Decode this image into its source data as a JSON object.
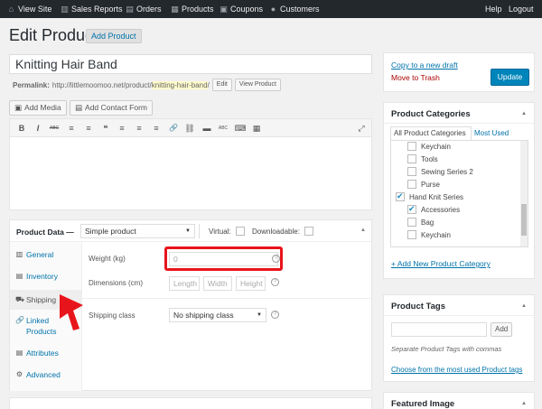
{
  "adminbar": {
    "items": [
      {
        "label": "View Site",
        "icon": "home-icon"
      },
      {
        "label": "Sales Reports",
        "icon": "chart-icon"
      },
      {
        "label": "Orders",
        "icon": "orders-icon"
      },
      {
        "label": "Products",
        "icon": "products-icon"
      },
      {
        "label": "Coupons",
        "icon": "coupons-icon"
      },
      {
        "label": "Customers",
        "icon": "customers-icon"
      }
    ],
    "help": "Help",
    "logout": "Logout"
  },
  "heading": {
    "title": "Edit Product",
    "add_button": "Add Product"
  },
  "post": {
    "title": "Knitting Hair Band",
    "permalink_label": "Permalink:",
    "permalink_base": "http://littlemoomoo.net/product/",
    "permalink_slug": "knitting-hair-band",
    "permalink_end": "/",
    "edit_button": "Edit",
    "view_button": "View Product"
  },
  "editor": {
    "add_media": "Add Media",
    "add_contact_form": "Add Contact Form",
    "toolbar": [
      "B",
      "I",
      "ABC",
      "≡",
      "≡",
      "❝",
      "≡",
      "≡",
      "≡",
      "🔗",
      "⛓",
      "▬",
      "ABC",
      "⌨",
      "▦"
    ],
    "fullscreen": "⤢"
  },
  "product_data": {
    "label": "Product Data —",
    "type_selected": "Simple product",
    "virtual_label": "Virtual:",
    "downloadable_label": "Downloadable:",
    "tabs": [
      {
        "label": "General",
        "icon": "general-icon"
      },
      {
        "label": "Inventory",
        "icon": "inventory-icon"
      },
      {
        "label": "Shipping",
        "icon": "shipping-icon"
      },
      {
        "label": "Linked Products",
        "icon": "linked-icon"
      },
      {
        "label": "Attributes",
        "icon": "attributes-icon"
      },
      {
        "label": "Advanced",
        "icon": "advanced-icon"
      }
    ],
    "active_tab": "Shipping",
    "weight_label": "Weight (kg)",
    "weight_placeholder": "0",
    "dimensions_label": "Dimensions (cm)",
    "length_placeholder": "Length",
    "width_placeholder": "Width",
    "height_placeholder": "Height",
    "shipping_class_label": "Shipping class",
    "shipping_class_selected": "No shipping class"
  },
  "publish": {
    "copy_draft": "Copy to a new draft",
    "trash": "Move to Trash",
    "update": "Update"
  },
  "categories": {
    "title": "Product Categories",
    "tab_all": "All Product Categories",
    "tab_most_used": "Most Used",
    "items": [
      {
        "label": "Keychain",
        "checked": false,
        "level": 1
      },
      {
        "label": "Tools",
        "checked": false,
        "level": 1
      },
      {
        "label": "Sewing Series 2",
        "checked": false,
        "level": 1
      },
      {
        "label": "Purse",
        "checked": false,
        "level": 1
      },
      {
        "label": "Hand Knit Series",
        "checked": true,
        "level": 0
      },
      {
        "label": "Accessories",
        "checked": true,
        "level": 1
      },
      {
        "label": "Bag",
        "checked": false,
        "level": 1
      },
      {
        "label": "Keychain",
        "checked": false,
        "level": 1
      }
    ],
    "add_new": "+ Add New Product Category"
  },
  "tags": {
    "title": "Product Tags",
    "add_button": "Add",
    "hint": "Separate Product Tags with commas",
    "choose": "Choose from the most used Product tags"
  },
  "featured_image": {
    "title": "Featured Image"
  },
  "colors": {
    "accent": "#0073aa",
    "update_button": "#0085ba",
    "adminbar": "#23282d",
    "highlight": "#e8141b"
  }
}
